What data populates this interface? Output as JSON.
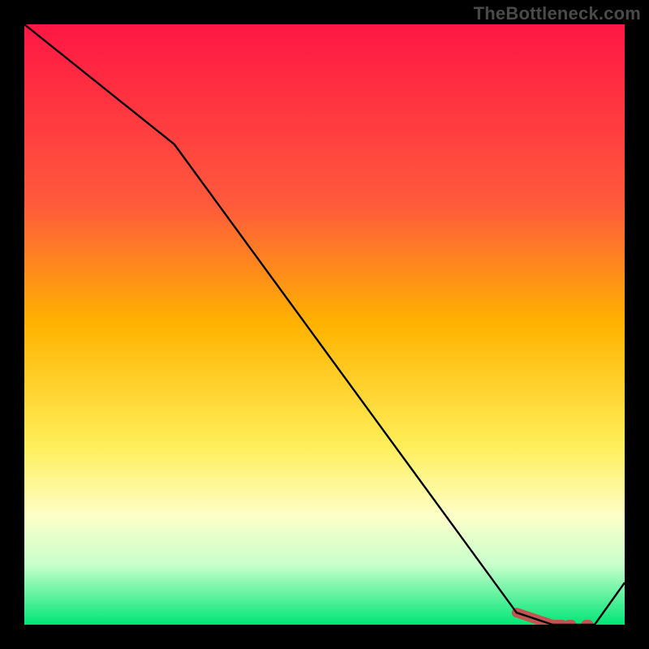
{
  "attribution": "TheBottleneck.com",
  "chart_data": {
    "type": "line",
    "title": "",
    "xlabel": "",
    "ylabel": "",
    "xlim": [
      0,
      100
    ],
    "ylim": [
      0,
      100
    ],
    "x": [
      0,
      25,
      82,
      88,
      95,
      100
    ],
    "values": [
      100,
      80,
      2,
      0,
      0,
      7
    ],
    "highlight_band": {
      "x_start": 82,
      "x_end": 95
    },
    "gradient_stops": [
      {
        "offset": 0,
        "color": "#ff1744"
      },
      {
        "offset": 30,
        "color": "#ff5a3c"
      },
      {
        "offset": 50,
        "color": "#ffb300"
      },
      {
        "offset": 70,
        "color": "#ffee58"
      },
      {
        "offset": 82,
        "color": "#fdffc9"
      },
      {
        "offset": 90,
        "color": "#c8ffcb"
      },
      {
        "offset": 100,
        "color": "#00e676"
      }
    ],
    "line_color": "#000000",
    "highlight_color": "#c1554f"
  }
}
